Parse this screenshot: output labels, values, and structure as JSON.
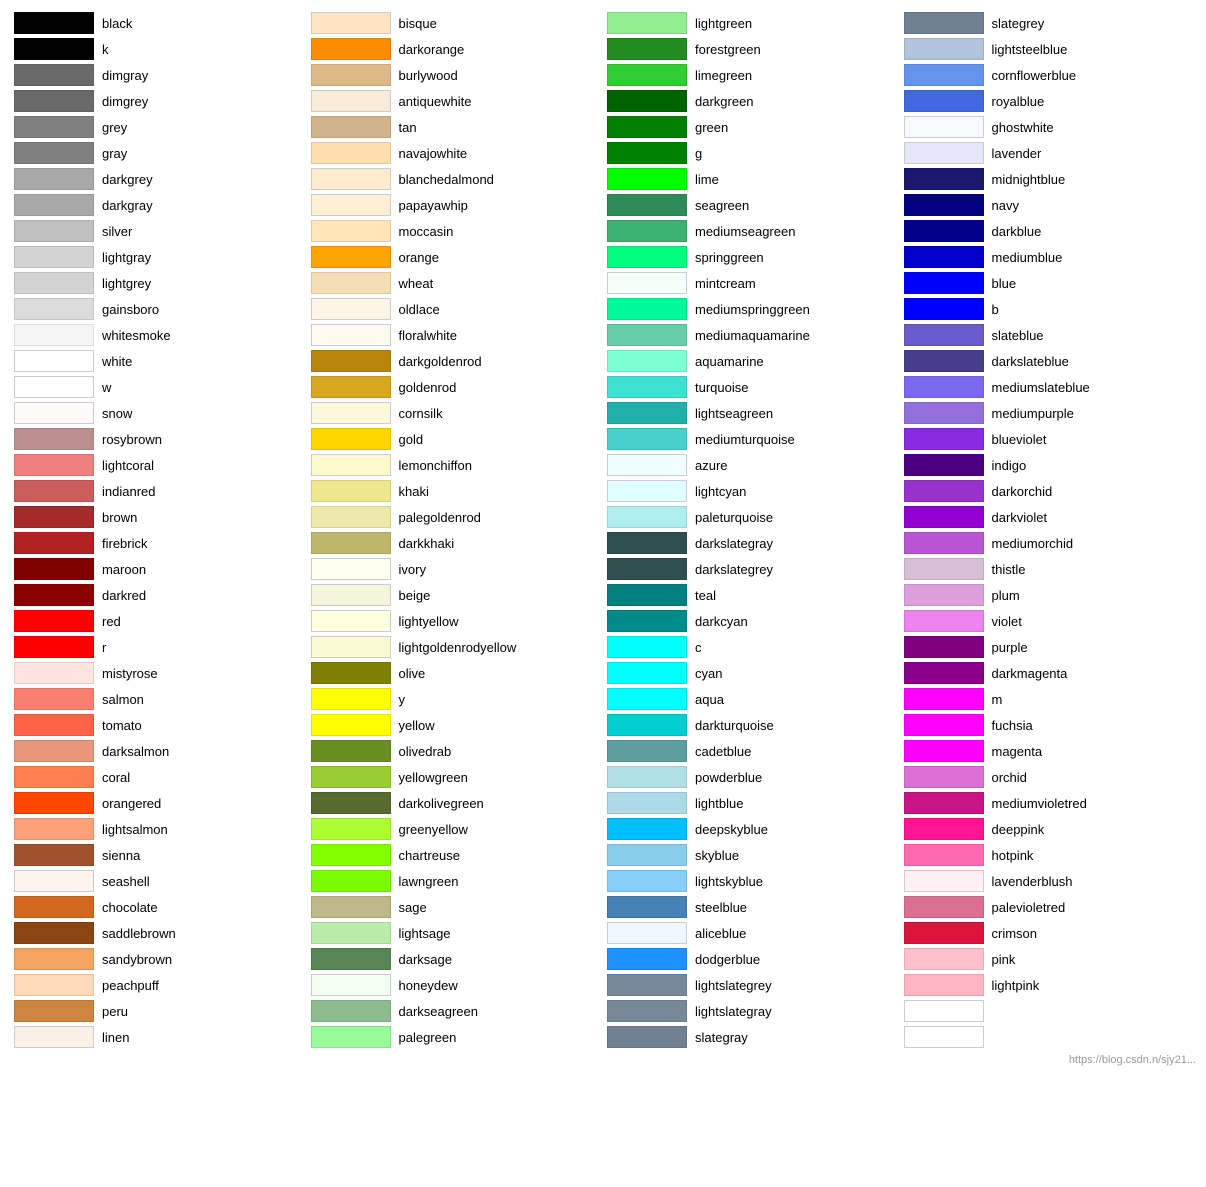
{
  "columns": [
    {
      "items": [
        {
          "name": "black",
          "color": "#000000"
        },
        {
          "name": "k",
          "color": "#000000"
        },
        {
          "name": "dimgray",
          "color": "#696969"
        },
        {
          "name": "dimgrey",
          "color": "#696969"
        },
        {
          "name": "grey",
          "color": "#808080"
        },
        {
          "name": "gray",
          "color": "#808080"
        },
        {
          "name": "darkgrey",
          "color": "#a9a9a9"
        },
        {
          "name": "darkgray",
          "color": "#a9a9a9"
        },
        {
          "name": "silver",
          "color": "#c0c0c0"
        },
        {
          "name": "lightgray",
          "color": "#d3d3d3"
        },
        {
          "name": "lightgrey",
          "color": "#d3d3d3"
        },
        {
          "name": "gainsboro",
          "color": "#dcdcdc"
        },
        {
          "name": "whitesmoke",
          "color": "#f5f5f5"
        },
        {
          "name": "white",
          "color": "#ffffff"
        },
        {
          "name": "w",
          "color": "#ffffff"
        },
        {
          "name": "snow",
          "color": "#fffafa"
        },
        {
          "name": "rosybrown",
          "color": "#bc8f8f"
        },
        {
          "name": "lightcoral",
          "color": "#f08080"
        },
        {
          "name": "indianred",
          "color": "#cd5c5c"
        },
        {
          "name": "brown",
          "color": "#a52a2a"
        },
        {
          "name": "firebrick",
          "color": "#b22222"
        },
        {
          "name": "maroon",
          "color": "#800000"
        },
        {
          "name": "darkred",
          "color": "#8b0000"
        },
        {
          "name": "red",
          "color": "#ff0000"
        },
        {
          "name": "r",
          "color": "#ff0000"
        },
        {
          "name": "mistyrose",
          "color": "#ffe4e1"
        },
        {
          "name": "salmon",
          "color": "#fa8072"
        },
        {
          "name": "tomato",
          "color": "#ff6347"
        },
        {
          "name": "darksalmon",
          "color": "#e9967a"
        },
        {
          "name": "coral",
          "color": "#ff7f50"
        },
        {
          "name": "orangered",
          "color": "#ff4500"
        },
        {
          "name": "lightsalmon",
          "color": "#ffa07a"
        },
        {
          "name": "sienna",
          "color": "#a0522d"
        },
        {
          "name": "seashell",
          "color": "#fff5ee"
        },
        {
          "name": "chocolate",
          "color": "#d2691e"
        },
        {
          "name": "saddlebrown",
          "color": "#8b4513"
        },
        {
          "name": "sandybrown",
          "color": "#f4a460"
        },
        {
          "name": "peachpuff",
          "color": "#ffdab9"
        },
        {
          "name": "peru",
          "color": "#cd853f"
        },
        {
          "name": "linen",
          "color": "#faf0e6"
        }
      ]
    },
    {
      "items": [
        {
          "name": "bisque",
          "color": "#ffe4c4"
        },
        {
          "name": "darkorange",
          "color": "#ff8c00"
        },
        {
          "name": "burlywood",
          "color": "#deb887"
        },
        {
          "name": "antiquewhite",
          "color": "#faebd7"
        },
        {
          "name": "tan",
          "color": "#d2b48c"
        },
        {
          "name": "navajowhite",
          "color": "#ffdead"
        },
        {
          "name": "blanchedalmond",
          "color": "#ffebcd"
        },
        {
          "name": "papayawhip",
          "color": "#ffefd5"
        },
        {
          "name": "moccasin",
          "color": "#ffe4b5"
        },
        {
          "name": "orange",
          "color": "#ffa500"
        },
        {
          "name": "wheat",
          "color": "#f5deb3"
        },
        {
          "name": "oldlace",
          "color": "#fdf5e6"
        },
        {
          "name": "floralwhite",
          "color": "#fffaf0"
        },
        {
          "name": "darkgoldenrod",
          "color": "#b8860b"
        },
        {
          "name": "goldenrod",
          "color": "#daa520"
        },
        {
          "name": "cornsilk",
          "color": "#fff8dc"
        },
        {
          "name": "gold",
          "color": "#ffd700"
        },
        {
          "name": "lemonchiffon",
          "color": "#fffacd"
        },
        {
          "name": "khaki",
          "color": "#f0e68c"
        },
        {
          "name": "palegoldenrod",
          "color": "#eee8aa"
        },
        {
          "name": "darkkhaki",
          "color": "#bdb76b"
        },
        {
          "name": "ivory",
          "color": "#fffff0"
        },
        {
          "name": "beige",
          "color": "#f5f5dc"
        },
        {
          "name": "lightyellow",
          "color": "#ffffe0"
        },
        {
          "name": "lightgoldenrodyellow",
          "color": "#fafad2"
        },
        {
          "name": "olive",
          "color": "#808000"
        },
        {
          "name": "y",
          "color": "#ffff00"
        },
        {
          "name": "yellow",
          "color": "#ffff00"
        },
        {
          "name": "olivedrab",
          "color": "#6b8e23"
        },
        {
          "name": "yellowgreen",
          "color": "#9acd32"
        },
        {
          "name": "darkolivegreen",
          "color": "#556b2f"
        },
        {
          "name": "greenyellow",
          "color": "#adff2f"
        },
        {
          "name": "chartreuse",
          "color": "#7fff00"
        },
        {
          "name": "lawngreen",
          "color": "#7cfc00"
        },
        {
          "name": "sage",
          "color": "#bcb88a"
        },
        {
          "name": "lightsage",
          "color": "#bcecac"
        },
        {
          "name": "darksage",
          "color": "#598556"
        },
        {
          "name": "honeydew",
          "color": "#f0fff0"
        },
        {
          "name": "darkseagreen",
          "color": "#8fbc8f"
        },
        {
          "name": "palegreen",
          "color": "#98fb98"
        }
      ]
    },
    {
      "items": [
        {
          "name": "lightgreen",
          "color": "#90ee90"
        },
        {
          "name": "forestgreen",
          "color": "#228b22"
        },
        {
          "name": "limegreen",
          "color": "#32cd32"
        },
        {
          "name": "darkgreen",
          "color": "#006400"
        },
        {
          "name": "green",
          "color": "#008000"
        },
        {
          "name": "g",
          "color": "#008000"
        },
        {
          "name": "lime",
          "color": "#00ff00"
        },
        {
          "name": "seagreen",
          "color": "#2e8b57"
        },
        {
          "name": "mediumseagreen",
          "color": "#3cb371"
        },
        {
          "name": "springgreen",
          "color": "#00ff7f"
        },
        {
          "name": "mintcream",
          "color": "#f5fffa"
        },
        {
          "name": "mediumspringgreen",
          "color": "#00fa9a"
        },
        {
          "name": "mediumaquamarine",
          "color": "#66cdaa"
        },
        {
          "name": "aquamarine",
          "color": "#7fffd4"
        },
        {
          "name": "turquoise",
          "color": "#40e0d0"
        },
        {
          "name": "lightseagreen",
          "color": "#20b2aa"
        },
        {
          "name": "mediumturquoise",
          "color": "#48d1cc"
        },
        {
          "name": "azure",
          "color": "#f0ffff"
        },
        {
          "name": "lightcyan",
          "color": "#e0ffff"
        },
        {
          "name": "paleturquoise",
          "color": "#afeeee"
        },
        {
          "name": "darkslategray",
          "color": "#2f4f4f"
        },
        {
          "name": "darkslategrey",
          "color": "#2f4f4f"
        },
        {
          "name": "teal",
          "color": "#008080"
        },
        {
          "name": "darkcyan",
          "color": "#008b8b"
        },
        {
          "name": "c",
          "color": "#00ffff"
        },
        {
          "name": "cyan",
          "color": "#00ffff"
        },
        {
          "name": "aqua",
          "color": "#00ffff"
        },
        {
          "name": "darkturquoise",
          "color": "#00ced1"
        },
        {
          "name": "cadetblue",
          "color": "#5f9ea0"
        },
        {
          "name": "powderblue",
          "color": "#b0e0e6"
        },
        {
          "name": "lightblue",
          "color": "#add8e6"
        },
        {
          "name": "deepskyblue",
          "color": "#00bfff"
        },
        {
          "name": "skyblue",
          "color": "#87ceeb"
        },
        {
          "name": "lightskyblue",
          "color": "#87cefa"
        },
        {
          "name": "steelblue",
          "color": "#4682b4"
        },
        {
          "name": "aliceblue",
          "color": "#f0f8ff"
        },
        {
          "name": "dodgerblue",
          "color": "#1e90ff"
        },
        {
          "name": "lightslategrey",
          "color": "#778899"
        },
        {
          "name": "lightslategray",
          "color": "#778899"
        },
        {
          "name": "slategray",
          "color": "#708090"
        }
      ]
    },
    {
      "items": [
        {
          "name": "slategrey",
          "color": "#708090"
        },
        {
          "name": "lightsteelblue",
          "color": "#b0c4de"
        },
        {
          "name": "cornflowerblue",
          "color": "#6495ed"
        },
        {
          "name": "royalblue",
          "color": "#4169e1"
        },
        {
          "name": "ghostwhite",
          "color": "#f8f8ff"
        },
        {
          "name": "lavender",
          "color": "#e6e6fa"
        },
        {
          "name": "midnightblue",
          "color": "#191970"
        },
        {
          "name": "navy",
          "color": "#000080"
        },
        {
          "name": "darkblue",
          "color": "#00008b"
        },
        {
          "name": "mediumblue",
          "color": "#0000cd"
        },
        {
          "name": "blue",
          "color": "#0000ff"
        },
        {
          "name": "b",
          "color": "#0000ff"
        },
        {
          "name": "slateblue",
          "color": "#6a5acd"
        },
        {
          "name": "darkslateblue",
          "color": "#483d8b"
        },
        {
          "name": "mediumslateblue",
          "color": "#7b68ee"
        },
        {
          "name": "mediumpurple",
          "color": "#9370db"
        },
        {
          "name": "blueviolet",
          "color": "#8a2be2"
        },
        {
          "name": "indigo",
          "color": "#4b0082"
        },
        {
          "name": "darkorchid",
          "color": "#9932cc"
        },
        {
          "name": "darkviolet",
          "color": "#9400d3"
        },
        {
          "name": "mediumorchid",
          "color": "#ba55d3"
        },
        {
          "name": "thistle",
          "color": "#d8bfd8"
        },
        {
          "name": "plum",
          "color": "#dda0dd"
        },
        {
          "name": "violet",
          "color": "#ee82ee"
        },
        {
          "name": "purple",
          "color": "#800080"
        },
        {
          "name": "darkmagenta",
          "color": "#8b008b"
        },
        {
          "name": "m",
          "color": "#ff00ff"
        },
        {
          "name": "fuchsia",
          "color": "#ff00ff"
        },
        {
          "name": "magenta",
          "color": "#ff00ff"
        },
        {
          "name": "orchid",
          "color": "#da70d6"
        },
        {
          "name": "mediumvioletred",
          "color": "#c71585"
        },
        {
          "name": "deeppink",
          "color": "#ff1493"
        },
        {
          "name": "hotpink",
          "color": "#ff69b4"
        },
        {
          "name": "lavenderblush",
          "color": "#fff0f5"
        },
        {
          "name": "palevioletred",
          "color": "#db7093"
        },
        {
          "name": "crimson",
          "color": "#dc143c"
        },
        {
          "name": "pink",
          "color": "#ffc0cb"
        },
        {
          "name": "lightpink",
          "color": "#ffb6c1"
        },
        {
          "name": "",
          "color": "transparent"
        },
        {
          "name": "",
          "color": "transparent"
        }
      ]
    }
  ],
  "watermark": "https://blog.csdn.n/sjy21..."
}
